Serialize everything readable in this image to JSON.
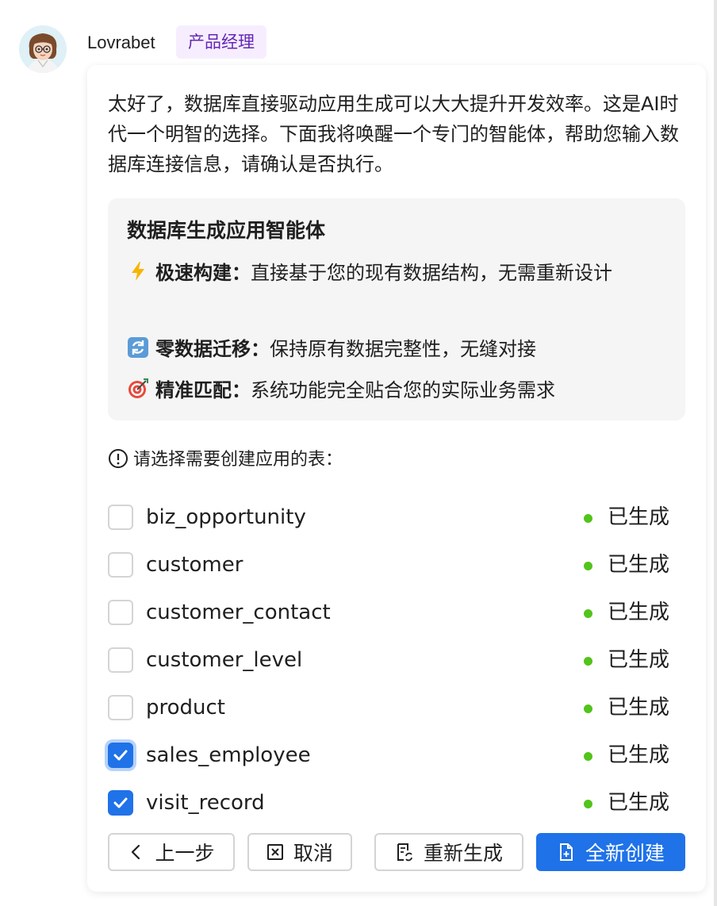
{
  "sender": {
    "name": "Lovrabet",
    "role": "产品经理"
  },
  "message": {
    "intro": "太好了，数据库直接驱动应用生成可以大大提升开发效率。这是AI时代一个明智的选择。下面我将唤醒一个专门的智能体，帮助您输入数据库连接信息，请确认是否执行。"
  },
  "agent_card": {
    "title": "数据库生成应用智能体",
    "features": [
      {
        "icon": "lightning-icon",
        "label": "极速构建：",
        "text": "直接基于您的现有数据结构，无需重新设计"
      },
      {
        "icon": "refresh-icon",
        "label": "零数据迁移：",
        "text": "保持原有数据完整性，无缝对接"
      },
      {
        "icon": "target-icon",
        "label": "精准匹配：",
        "text": "系统功能完全贴合您的实际业务需求"
      }
    ]
  },
  "table_select": {
    "prompt": "请选择需要创建应用的表：",
    "status_color": "#52c41a",
    "tables": [
      {
        "name": "biz_opportunity",
        "checked": false,
        "status": "已生成"
      },
      {
        "name": "customer",
        "checked": false,
        "status": "已生成"
      },
      {
        "name": "customer_contact",
        "checked": false,
        "status": "已生成"
      },
      {
        "name": "customer_level",
        "checked": false,
        "status": "已生成"
      },
      {
        "name": "product",
        "checked": false,
        "status": "已生成"
      },
      {
        "name": "sales_employee",
        "checked": true,
        "status": "已生成"
      },
      {
        "name": "visit_record",
        "checked": true,
        "status": "已生成"
      }
    ]
  },
  "actions": {
    "prev": "上一步",
    "cancel": "取消",
    "regenerate": "重新生成",
    "create": "全新创建"
  },
  "colors": {
    "primary": "#1f72e8",
    "badge_bg": "#f6eefe",
    "badge_text": "#6426b7"
  }
}
